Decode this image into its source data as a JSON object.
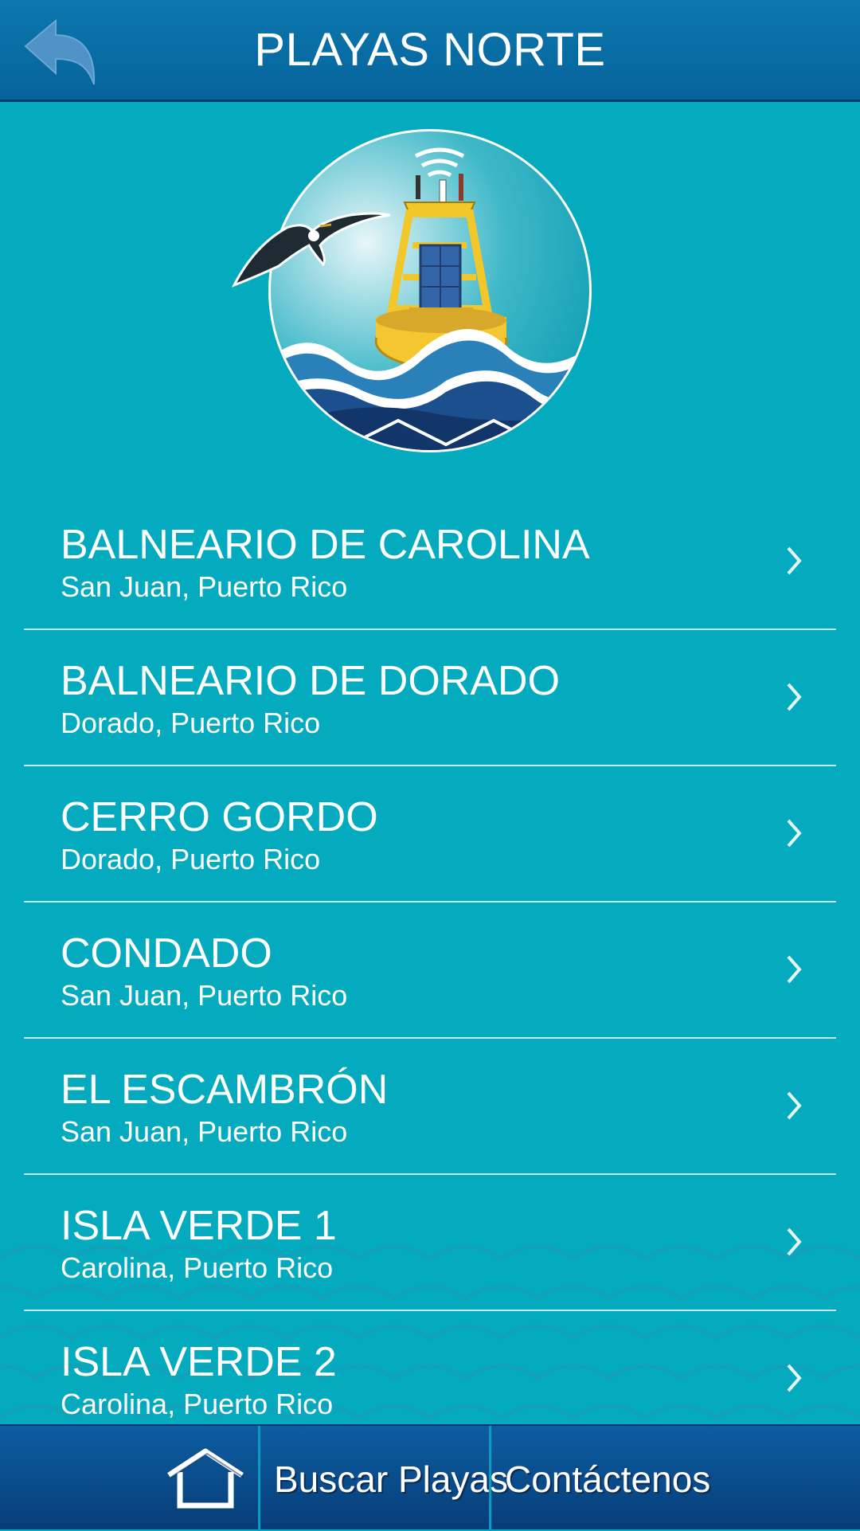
{
  "header": {
    "title": "PLAYAS NORTE"
  },
  "beaches": [
    {
      "name": "BALNEARIO DE CAROLINA",
      "location": "San Juan, Puerto Rico"
    },
    {
      "name": "BALNEARIO DE DORADO",
      "location": "Dorado, Puerto Rico"
    },
    {
      "name": "CERRO GORDO",
      "location": "Dorado, Puerto Rico"
    },
    {
      "name": "CONDADO",
      "location": "San Juan, Puerto Rico"
    },
    {
      "name": "EL ESCAMBRÓN",
      "location": "San Juan, Puerto Rico"
    },
    {
      "name": "ISLA VERDE 1",
      "location": "Carolina, Puerto Rico"
    },
    {
      "name": "ISLA VERDE 2",
      "location": "Carolina, Puerto Rico"
    }
  ],
  "tabbar": {
    "home_icon": "home-icon",
    "search_label": "Buscar Playas",
    "contact_label": "Contáctenos"
  },
  "colors": {
    "background": "#04aabe",
    "header": "#0a6ea6",
    "tabbar": "#0a4f90"
  }
}
